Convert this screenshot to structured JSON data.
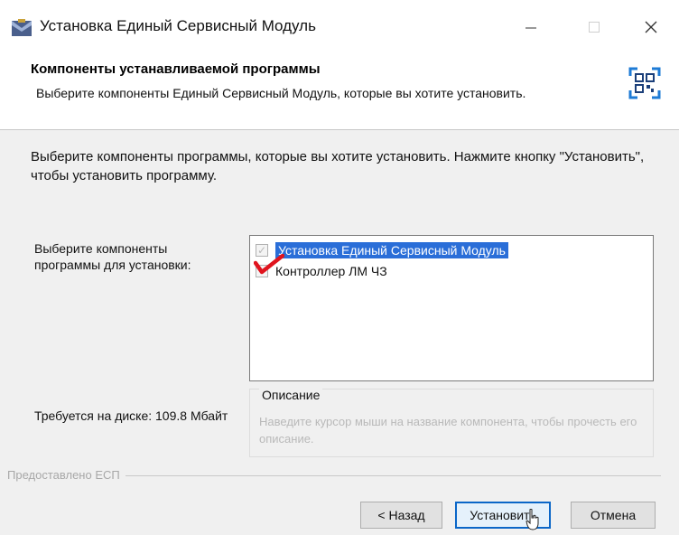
{
  "window": {
    "title": "Установка Единый Сервисный Модуль"
  },
  "header": {
    "title": "Компоненты устанавливаемой программы",
    "subtitle": "Выберите компоненты Единый Сервисный Модуль, которые вы хотите установить."
  },
  "intro": "Выберите компоненты программы, которые вы хотите установить. Нажмите кнопку \"Установить\", чтобы установить программу.",
  "components": {
    "label": "Выберите компоненты программы для установки:",
    "items": [
      {
        "label": "Установка Единый Сервисный Модуль",
        "checked": true,
        "selected": true
      },
      {
        "label": "Контроллер ЛМ ЧЗ",
        "checked": true,
        "selected": false
      }
    ]
  },
  "description": {
    "title": "Описание",
    "text": "Наведите курсор мыши на название компонента, чтобы прочесть его описание."
  },
  "disk": "Требуется на диске: 109.8 Мбайт",
  "branding": "Предоставлено ЕСП",
  "buttons": {
    "back": "< Назад",
    "install": "Установить",
    "cancel": "Отмена"
  },
  "colors": {
    "selection": "#2a6ed8",
    "annotation_check": "#e0141e",
    "default_button_border": "#0a66c8"
  }
}
